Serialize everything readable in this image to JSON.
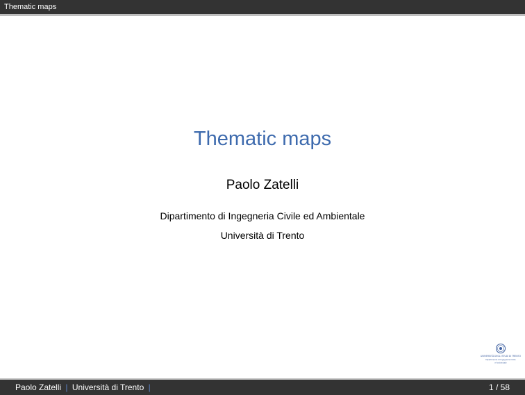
{
  "header": {
    "section_title": "Thematic maps"
  },
  "title_slide": {
    "title": "Thematic maps",
    "author": "Paolo Zatelli",
    "institute_lines": [
      "Dipartimento di Ingegneria Civile ed Ambientale",
      "Università di Trento"
    ]
  },
  "logo": {
    "icon": "university-seal-icon",
    "text_lines": [
      "UNIVERSITÀ DEGLI STUDI DI TRENTO",
      "Dipartimento di Ingegneria Civile",
      "e Ambientale"
    ],
    "color": "#3d5fa0"
  },
  "footer": {
    "author": "Paolo Zatelli",
    "separator": "|",
    "institute": "Università di Trento",
    "page": "1 / 58"
  },
  "colors": {
    "bar": "#333333",
    "title": "#3d6aad",
    "separator": "#5a7fc0"
  }
}
